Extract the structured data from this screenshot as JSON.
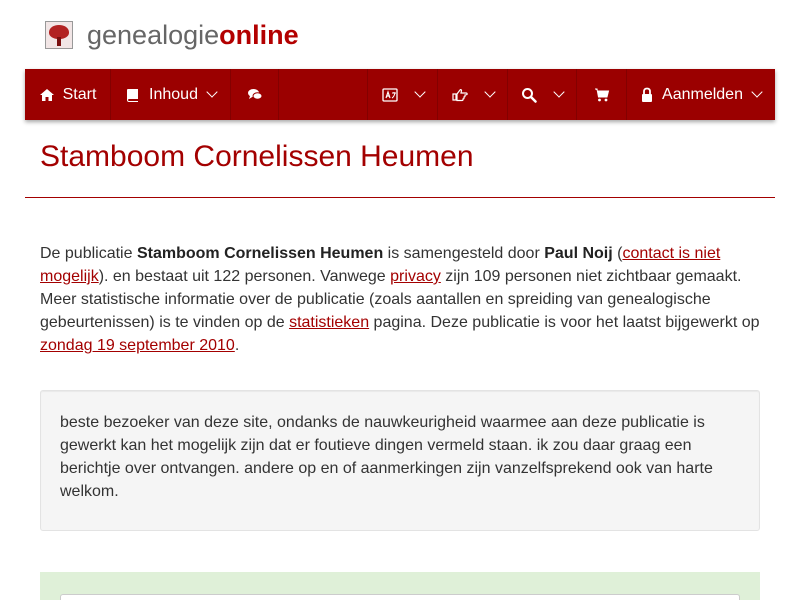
{
  "brand": {
    "part1": "genealogie",
    "part2": "online"
  },
  "nav": {
    "start": "Start",
    "inhoud": "Inhoud",
    "aanmelden": "Aanmelden"
  },
  "page": {
    "title": "Stamboom Cornelissen Heumen"
  },
  "intro": {
    "t1": "De publicatie ",
    "pub": "Stamboom Cornelissen Heumen",
    "t2": " is samengesteld door ",
    "author": "Paul Noij",
    "t3": " (",
    "contact_link": "contact is niet mogelijk",
    "t4": "). en bestaat uit 122 personen. Vanwege ",
    "privacy_link": "privacy",
    "t5": " zijn 109 personen niet zichtbaar gemaakt. Meer statistische informatie over de publicatie (zoals aantallen en spreiding van genealogische gebeurtenissen) is te vinden op de ",
    "stats_link": "statistieken",
    "t6": " pagina. Deze publicatie is voor het laatst bijgewerkt op ",
    "date_link": "zondag 19 september 2010",
    "t7": "."
  },
  "note": "beste bezoeker van deze site, ondanks de nauwkeurigheid waarmee aan deze publicatie is gewerkt kan het mogelijk zijn dat er foutieve dingen vermeld staan. ik zou daar graag een berichtje over ontvangen. andere op en of aanmerkingen zijn vanzelfsprekend ook van harte welkom.",
  "colors": {
    "brand_red": "#9b0000",
    "heading_red": "#a30000",
    "note_bg": "#f5f5f5",
    "success_bg": "#dff0d8"
  },
  "icons": [
    "home-icon",
    "book-icon",
    "comments-icon",
    "language-icon",
    "hand-point-icon",
    "search-icon",
    "cart-icon",
    "lock-icon"
  ]
}
